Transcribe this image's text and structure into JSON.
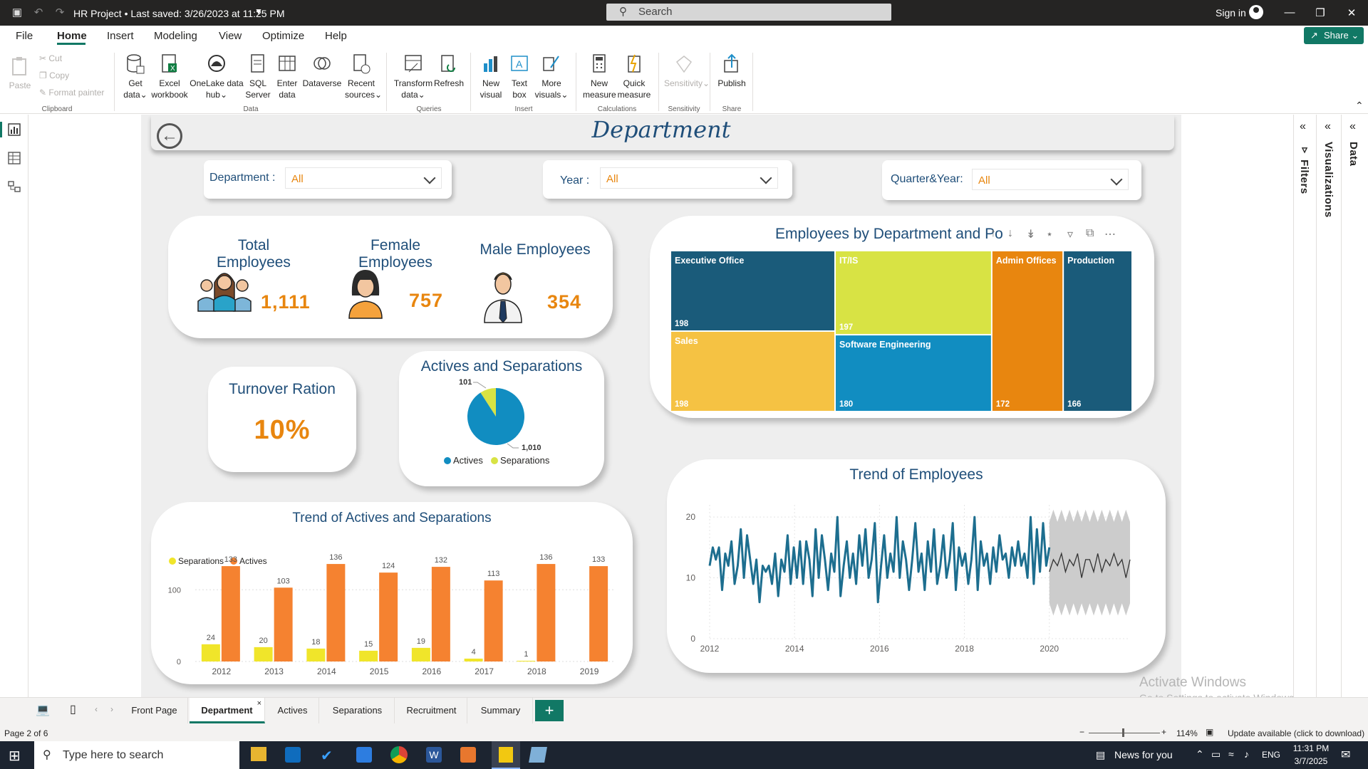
{
  "titlebar": {
    "title": "HR Project • Last saved: 3/26/2023 at 11:25 PM",
    "search_placeholder": "Search",
    "sign_in": "Sign in"
  },
  "menu": {
    "items": [
      "File",
      "Home",
      "Insert",
      "Modeling",
      "View",
      "Optimize",
      "Help"
    ],
    "active": "Home",
    "share": "Share"
  },
  "ribbon": {
    "clipboard": {
      "paste": "Paste",
      "cut": "Cut",
      "copy": "Copy",
      "format_painter": "Format painter",
      "group": "Clipboard"
    },
    "data": {
      "get_data": "Get data",
      "excel": "Excel workbook",
      "onelake": "OneLake data hub",
      "sql": "SQL Server",
      "enter": "Enter data",
      "dataverse": "Dataverse",
      "recent": "Recent sources",
      "group": "Data"
    },
    "queries": {
      "transform": "Transform data",
      "refresh": "Refresh",
      "group": "Queries"
    },
    "insert": {
      "new_visual": "New visual",
      "text_box": "Text box",
      "more_visuals": "More visuals",
      "group": "Insert"
    },
    "calculations": {
      "new_measure": "New measure",
      "quick_measure": "Quick measure",
      "group": "Calculations"
    },
    "sensitivity": {
      "label": "Sensitivity",
      "group": "Sensitivity"
    },
    "share": {
      "publish": "Publish",
      "group": "Share"
    }
  },
  "panes": {
    "filters": "Filters",
    "visualizations": "Visualizations",
    "data": "Data"
  },
  "report": {
    "title": "Department",
    "slicers": [
      {
        "label": "Department :",
        "value": "All"
      },
      {
        "label": "Year :",
        "value": "All"
      },
      {
        "label": "Quarter&Year:",
        "value": "All"
      }
    ],
    "kpis": {
      "total_label": "Total Employees",
      "total_value": "1,111",
      "female_label": "Female Employees",
      "female_value": "757",
      "male_label": "Male Employees",
      "male_value": "354"
    },
    "turnover": {
      "label": "Turnover Ration",
      "value": "10%"
    },
    "pie_title": "Actives and Separations",
    "bar_title": "Trend of Actives and Separations",
    "treemap_title": "Employees by Department and Po",
    "trend_title": "Trend of Employees"
  },
  "chart_data": [
    {
      "type": "pie",
      "title": "Actives and Separations",
      "categories": [
        "Actives",
        "Separations"
      ],
      "values": [
        1010,
        101
      ],
      "labels": [
        "1,010",
        "101"
      ],
      "colors": [
        "#118dc1",
        "#d8e344"
      ],
      "legend": "bottom"
    },
    {
      "type": "treemap",
      "title": "Employees by Department and Po",
      "categories": [
        "Executive Office",
        "IT/IS",
        "Admin Offices",
        "Production",
        "Sales",
        "Software Engineering"
      ],
      "values": [
        198,
        197,
        172,
        166,
        198,
        180
      ],
      "colors": [
        "#1a5b7a",
        "#d8e344",
        "#e8860f",
        "#1a5b7a",
        "#f5c243",
        "#118dc1"
      ]
    },
    {
      "type": "bar",
      "title": "Trend of Actives and Separations",
      "categories": [
        "2012",
        "2013",
        "2014",
        "2015",
        "2016",
        "2017",
        "2018",
        "2019"
      ],
      "series": [
        {
          "name": "Separations",
          "values": [
            24,
            20,
            18,
            15,
            19,
            4,
            1,
            null
          ],
          "color": "#f0e52a"
        },
        {
          "name": "Actives",
          "values": [
            133,
            103,
            136,
            124,
            132,
            113,
            136,
            133
          ],
          "color": "#f58230"
        }
      ],
      "yticks": [
        "0",
        "100"
      ],
      "ylim": [
        0,
        145
      ],
      "legend": "top-left"
    },
    {
      "type": "line",
      "title": "Trend of Employees",
      "x_start": 2012,
      "x_end": 2021.9,
      "xticks": [
        "2012",
        "2014",
        "2016",
        "2018",
        "2020"
      ],
      "yticks": [
        "0",
        "10",
        "20"
      ],
      "ylim": [
        0,
        22
      ],
      "actual": [
        12,
        15,
        13,
        15,
        8,
        14,
        12,
        16,
        9,
        12,
        18,
        10,
        17,
        13,
        9,
        13,
        6,
        12,
        11,
        12,
        9,
        14,
        7,
        13,
        11,
        17,
        9,
        15,
        10,
        16,
        9,
        16,
        13,
        7,
        18,
        10,
        17,
        13,
        8,
        14,
        11,
        20,
        7,
        12,
        16,
        10,
        14,
        9,
        17,
        12,
        18,
        10,
        13,
        19,
        6,
        12,
        17,
        10,
        14,
        11,
        20,
        10,
        16,
        13,
        8,
        13,
        19,
        11,
        14,
        8,
        16,
        11,
        18,
        9,
        12,
        17,
        10,
        13,
        19,
        8,
        15,
        12,
        14,
        9,
        13,
        20,
        8,
        16,
        12,
        14,
        9,
        15,
        11,
        17,
        13,
        14,
        10,
        15,
        12,
        16,
        12,
        14,
        10,
        20,
        9,
        18,
        11,
        19,
        12,
        15
      ],
      "forecast": [
        11,
        13,
        12,
        14,
        11,
        13,
        12,
        14,
        10,
        13,
        13,
        11,
        14,
        11,
        13,
        12,
        14,
        12,
        13,
        10,
        13
      ],
      "forecast_band": [
        5,
        20
      ],
      "colors": {
        "line": "#1d6e8f",
        "forecast": "#333333",
        "band": "#cccccc"
      }
    }
  ],
  "page_tabs": [
    "Front Page",
    "Department",
    "Actives",
    "Separations",
    "Recruitment",
    "Summary"
  ],
  "active_tab": "Department",
  "status": {
    "page": "Page 2 of 6",
    "zoom": "114%",
    "update": "Update available (click to download)"
  },
  "watermark": {
    "line1": "Activate Windows",
    "line2": "Go to Settings to activate Windows."
  },
  "taskbar": {
    "search_placeholder": "Type here to search",
    "news": "News for you",
    "lang": "ENG",
    "time": "11:31 PM",
    "date": "3/7/2025"
  }
}
